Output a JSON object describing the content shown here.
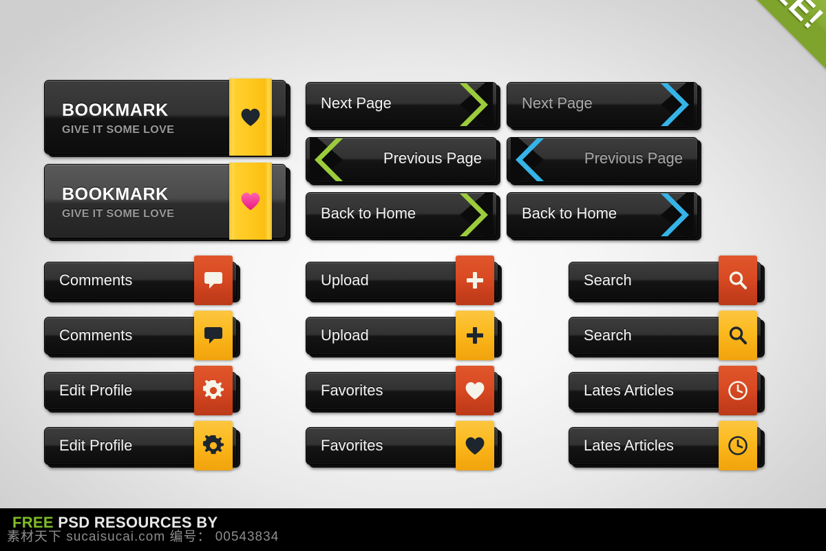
{
  "ribbon": {
    "label": "FREE!",
    "color": "#87ac34"
  },
  "palette": {
    "background": "#f2f2f2",
    "button_dark": "#1a1a1a",
    "button_light": "#4a4a4a",
    "accent_red": "#d24a22",
    "accent_yellow": "#fbb91d",
    "accent_green": "#9ccc3c",
    "accent_blue": "#35b4e8",
    "accent_gold": "#ffc81f",
    "heart_pink": "#f0338f"
  },
  "bookmark_buttons": [
    {
      "title": "BOOKMARK",
      "subtitle": "GIVE IT SOME LOVE",
      "icon": "heart-icon",
      "icon_color": "#1d262e",
      "style": "dark"
    },
    {
      "title": "BOOKMARK",
      "subtitle": "GIVE IT SOME LOVE",
      "icon": "heart-icon",
      "icon_color": "#f0338f",
      "style": "light"
    }
  ],
  "nav_buttons_green": [
    {
      "label": "Next Page",
      "direction": "right",
      "arrow_color": "#9ccc3c",
      "icon": "chevron-right-icon"
    },
    {
      "label": "Previous Page",
      "direction": "left",
      "arrow_color": "#9ccc3c",
      "icon": "chevron-left-icon"
    },
    {
      "label": "Back to Home",
      "direction": "right",
      "arrow_color": "#9ccc3c",
      "icon": "chevron-right-icon"
    }
  ],
  "nav_buttons_blue": [
    {
      "label": "Next Page",
      "direction": "right",
      "arrow_color": "#35b4e8",
      "icon": "chevron-right-icon"
    },
    {
      "label": "Previous Page",
      "direction": "left",
      "arrow_color": "#35b4e8",
      "icon": "chevron-left-icon"
    },
    {
      "label": "Back to Home",
      "direction": "right",
      "arrow_color": "#35b4e8",
      "icon": "chevron-right-icon"
    }
  ],
  "icon_buttons_col1": [
    {
      "label": "Comments",
      "icon": "speech-bubble-icon",
      "tab_color": "red",
      "glyph_color": "#f4f4ea"
    },
    {
      "label": "Comments",
      "icon": "speech-bubble-icon",
      "tab_color": "yel",
      "glyph_color": "#1d262e"
    },
    {
      "label": "Edit Profile",
      "icon": "gear-icon",
      "tab_color": "red",
      "glyph_color": "#f4f4ea"
    },
    {
      "label": "Edit Profile",
      "icon": "gear-icon",
      "tab_color": "yel",
      "glyph_color": "#1d262e"
    }
  ],
  "icon_buttons_col2": [
    {
      "label": "Upload",
      "icon": "plus-icon",
      "tab_color": "red",
      "glyph_color": "#f4f4ea"
    },
    {
      "label": "Upload",
      "icon": "plus-icon",
      "tab_color": "yel",
      "glyph_color": "#1d262e"
    },
    {
      "label": "Favorites",
      "icon": "heart-icon",
      "tab_color": "red",
      "glyph_color": "#f4f4ea"
    },
    {
      "label": "Favorites",
      "icon": "heart-icon",
      "tab_color": "yel",
      "glyph_color": "#1d262e"
    }
  ],
  "icon_buttons_col3": [
    {
      "label": "Search",
      "icon": "search-icon",
      "tab_color": "red",
      "glyph_color": "#f4f4ea"
    },
    {
      "label": "Search",
      "icon": "search-icon",
      "tab_color": "yel",
      "glyph_color": "#1d262e"
    },
    {
      "label": "Lates Articles",
      "icon": "clock-icon",
      "tab_color": "red",
      "glyph_color": "#f4f4ea"
    },
    {
      "label": "Lates Articles",
      "icon": "clock-icon",
      "tab_color": "yel",
      "glyph_color": "#1d262e"
    }
  ],
  "footer": {
    "free_word": "FREE",
    "rest_text": " PSD RESOURCES BY",
    "watermark": "素材天下 sucaisucai.com 编号： 00543834"
  }
}
